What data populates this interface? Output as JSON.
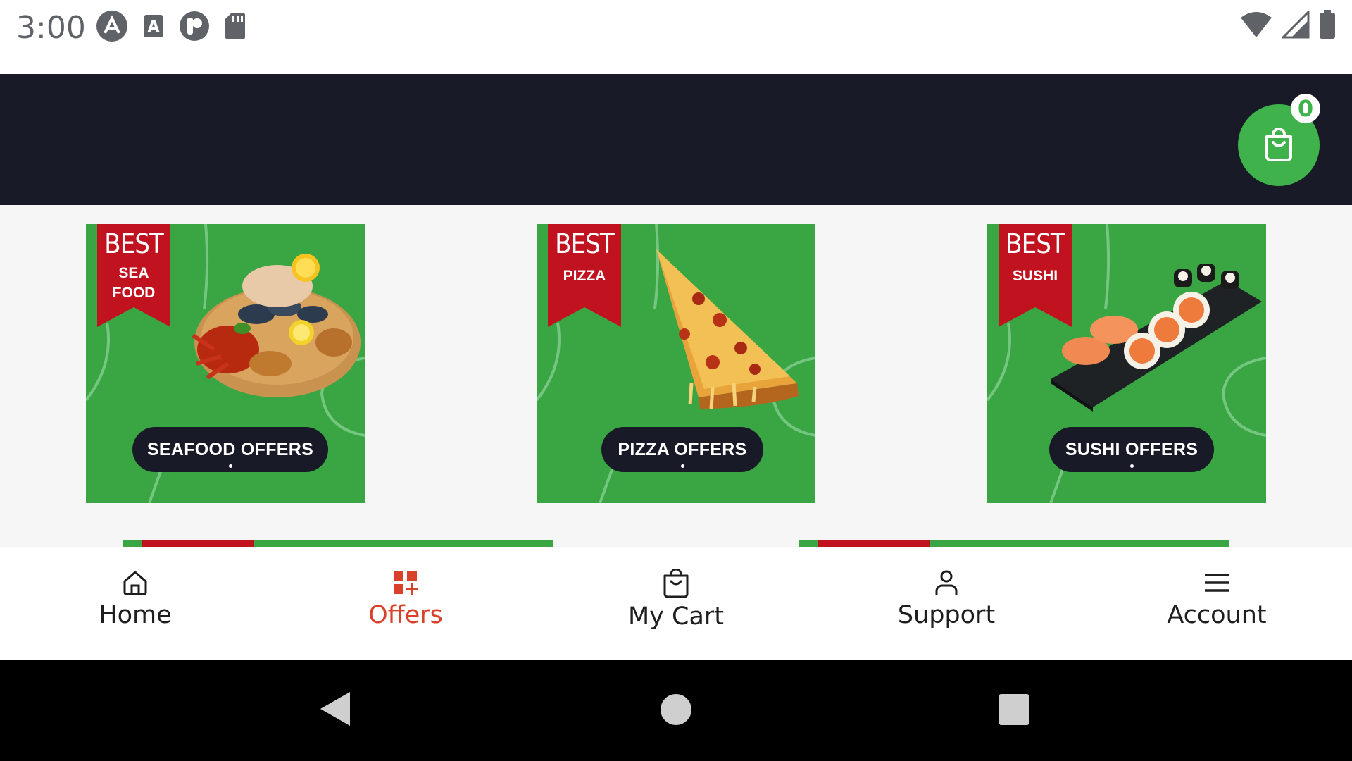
{
  "status_bar": {
    "time": "3:00",
    "left_icons": [
      "angular-icon",
      "text-a-icon",
      "r-circle-icon",
      "sd-card-icon"
    ],
    "right_icons": [
      "wifi-icon",
      "signal-icon",
      "battery-icon"
    ]
  },
  "header": {
    "cart_count": "0",
    "cart_icon": "shopping-bag-icon",
    "fab_color": "#3fb24c"
  },
  "offers": [
    {
      "ribbon_title": "BEST",
      "ribbon_sub_1": "SEA",
      "ribbon_sub_2": "FOOD",
      "button_label": "SEAFOOD OFFERS",
      "image": "seafood-platter"
    },
    {
      "ribbon_title": "BEST",
      "ribbon_sub_1": "PIZZA",
      "ribbon_sub_2": "",
      "button_label": "PIZZA OFFERS",
      "image": "pizza-slice"
    },
    {
      "ribbon_title": "BEST",
      "ribbon_sub_1": "SUSHI",
      "ribbon_sub_2": "",
      "button_label": "SUSHI OFFERS",
      "image": "sushi-board"
    }
  ],
  "bottom_nav": {
    "items": [
      {
        "label": "Home",
        "icon": "home-icon",
        "active": false
      },
      {
        "label": "Offers",
        "icon": "offers-grid-icon",
        "active": true
      },
      {
        "label": "My Cart",
        "icon": "shopping-bag-icon",
        "active": false
      },
      {
        "label": "Support",
        "icon": "person-icon",
        "active": false
      },
      {
        "label": "Account",
        "icon": "menu-icon",
        "active": false
      }
    ],
    "active_color": "#d9412a"
  },
  "system_nav": [
    "back-icon",
    "home-circle-icon",
    "recents-icon"
  ],
  "colors": {
    "header_bg": "#181a27",
    "card_green": "#3aa543",
    "ribbon_red": "#c1121f"
  }
}
